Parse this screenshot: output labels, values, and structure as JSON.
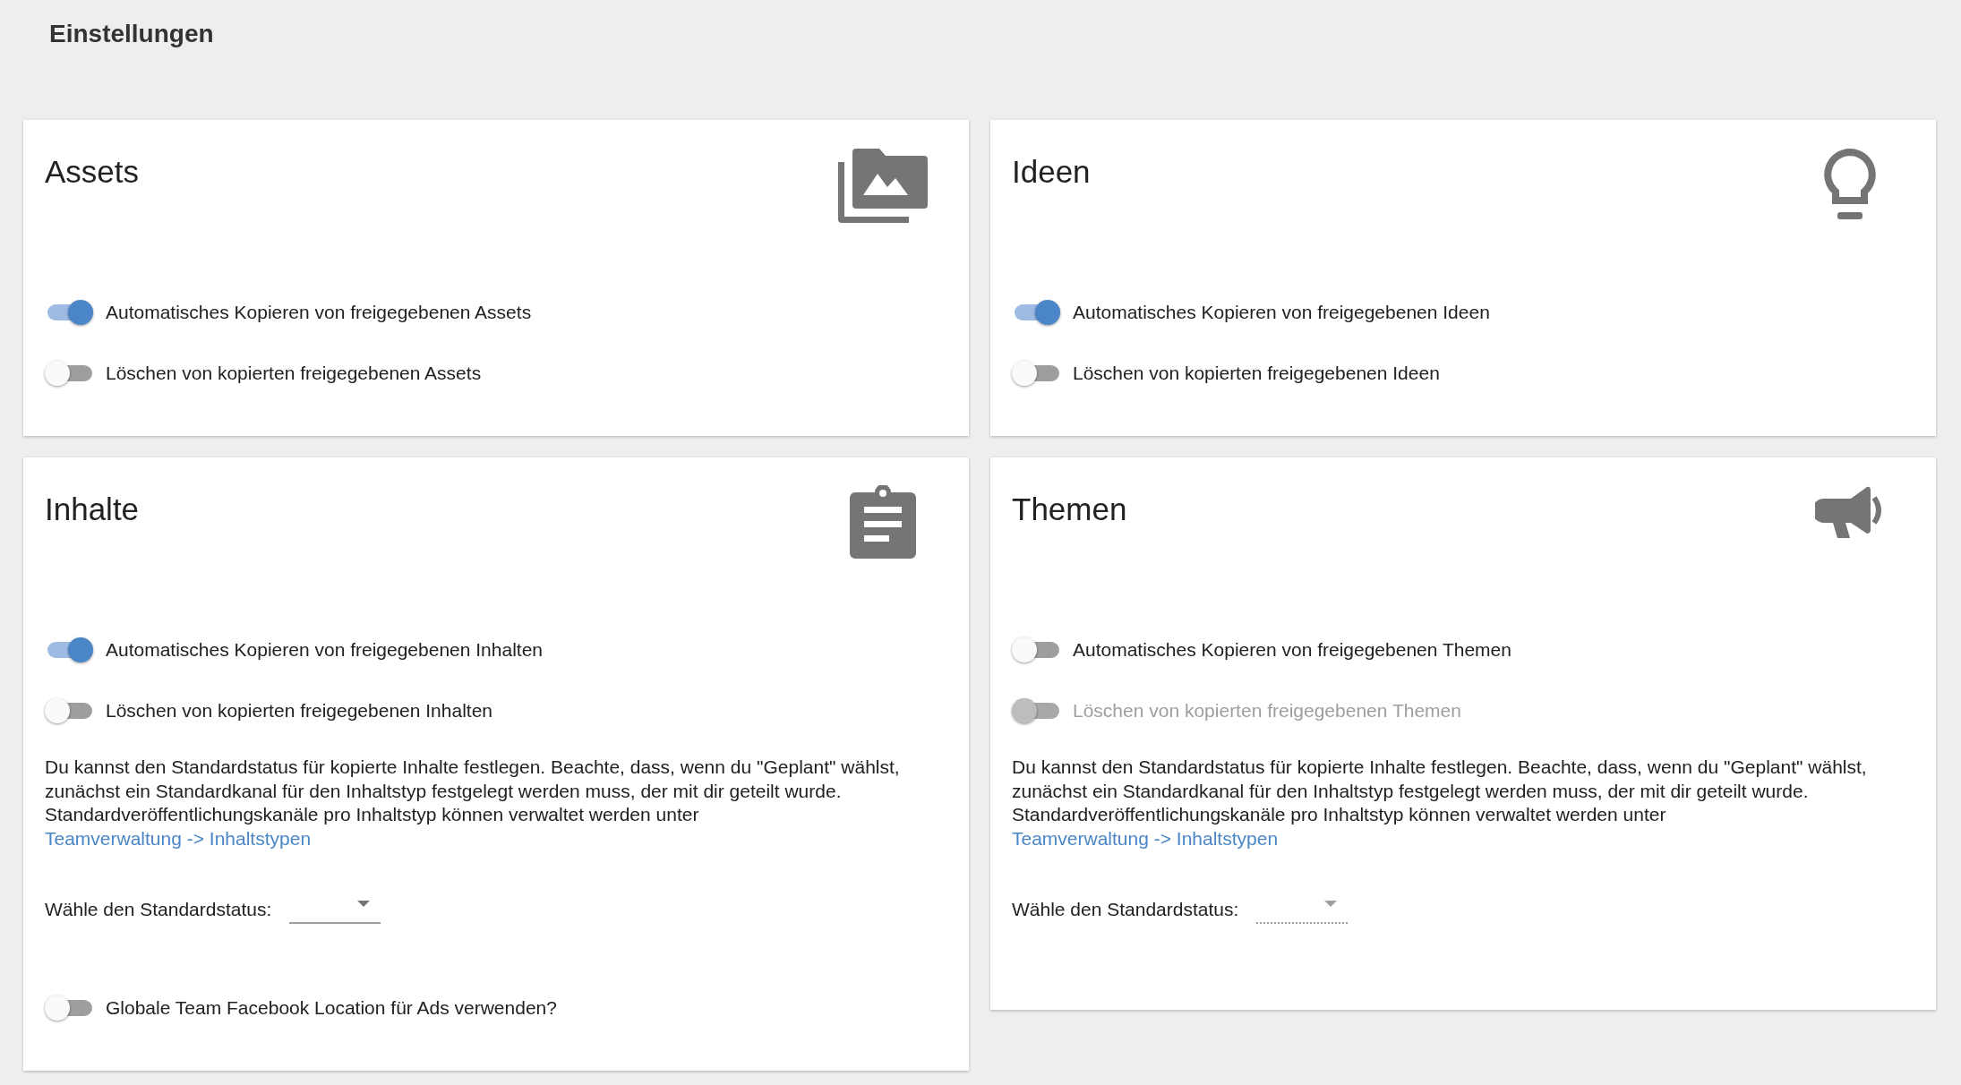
{
  "page_title": "Einstellungen",
  "cards": [
    {
      "title": "Assets",
      "items": [
        {
          "kind": "toggle",
          "label": "Automatisches Kopieren von freigegebenen Assets",
          "on": true,
          "disabled": false
        },
        {
          "kind": "toggle",
          "label": "Löschen von kopierten freigegebenen Assets",
          "on": false,
          "disabled": false
        }
      ]
    },
    {
      "title": "Ideen",
      "items": [
        {
          "kind": "toggle",
          "label": "Automatisches Kopieren von freigegebenen Ideen",
          "on": true,
          "disabled": false
        },
        {
          "kind": "toggle",
          "label": "Löschen von kopierten freigegebenen Ideen",
          "on": false,
          "disabled": false
        }
      ]
    },
    {
      "title": "Inhalte",
      "items": [
        {
          "kind": "toggle",
          "label": "Automatisches Kopieren von freigegebenen Inhalten",
          "on": true,
          "disabled": false
        },
        {
          "kind": "toggle",
          "label": "Löschen von kopierten freigegebenen Inhalten",
          "on": false,
          "disabled": false
        },
        {
          "kind": "info",
          "text": "Du kannst den Standardstatus für kopierte Inhalte festlegen. Beachte, dass, wenn du \"Geplant\" wählst, zunächst ein Standardkanal für den Inhaltstyp festgelegt werden muss, der mit dir geteilt wurde. Standardveröffentlichungskanäle pro Inhaltstyp können verwaltet werden unter",
          "link": "Teamverwaltung -> Inhaltstypen"
        },
        {
          "kind": "select",
          "label": "Wähle den Standardstatus:",
          "disabled": false
        },
        {
          "kind": "toggle",
          "label": "Globale Team Facebook Location für Ads verwenden?",
          "on": false,
          "disabled": false
        }
      ]
    },
    {
      "title": "Themen",
      "items": [
        {
          "kind": "toggle",
          "label": "Automatisches Kopieren von freigegebenen Themen",
          "on": false,
          "disabled": false
        },
        {
          "kind": "toggle",
          "label": "Löschen von kopierten freigegebenen Themen",
          "on": false,
          "disabled": true
        },
        {
          "kind": "info",
          "text": "Du kannst den Standardstatus für kopierte Inhalte festlegen. Beachte, dass, wenn du \"Geplant\" wählst, zunächst ein Standardkanal für den Inhaltstyp festgelegt werden muss, der mit dir geteilt wurde. Standardveröffentlichungskanäle pro Inhaltstyp können verwaltet werden unter",
          "link": "Teamverwaltung -> Inhaltstypen"
        },
        {
          "kind": "select",
          "label": "Wähle den Standardstatus:",
          "disabled": true
        }
      ]
    }
  ]
}
